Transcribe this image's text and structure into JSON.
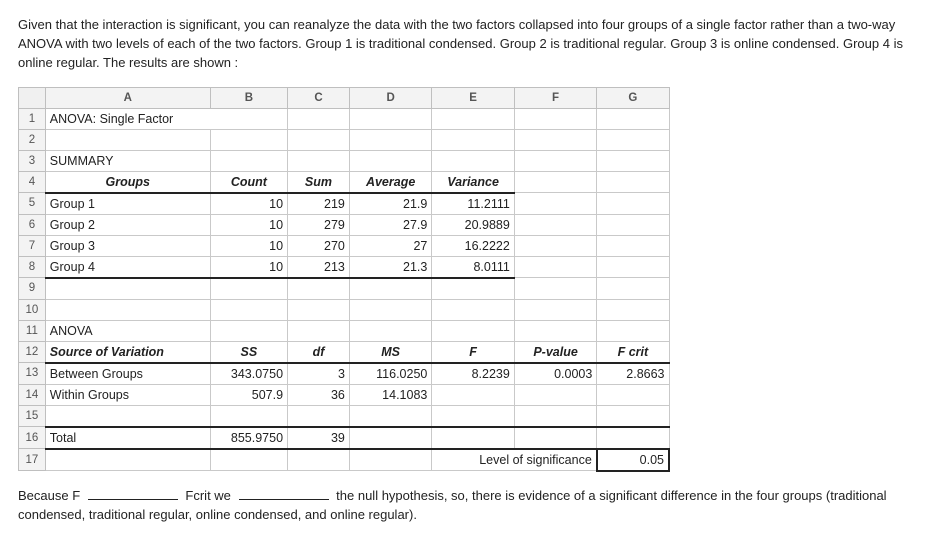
{
  "intro": "Given that the interaction is significant, you can reanalyze the data with the two factors collapsed into four groups of a single factor rather than a two-way ANOVA with two levels of each of the two factors.  Group 1 is traditional condensed. Group 2 is traditional regular. Group 3 is online condensed. Group 4 is online regular. The results are shown :",
  "cols": {
    "A": "A",
    "B": "B",
    "C": "C",
    "D": "D",
    "E": "E",
    "F": "F",
    "G": "G"
  },
  "rows": {
    "r1A": "ANOVA: Single Factor",
    "r3A": "SUMMARY",
    "r4": {
      "A": "Groups",
      "B": "Count",
      "C": "Sum",
      "D": "Average",
      "E": "Variance"
    },
    "r5": {
      "A": "Group 1",
      "B": "10",
      "C": "219",
      "D": "21.9",
      "E": "11.2111"
    },
    "r6": {
      "A": "Group 2",
      "B": "10",
      "C": "279",
      "D": "27.9",
      "E": "20.9889"
    },
    "r7": {
      "A": "Group 3",
      "B": "10",
      "C": "270",
      "D": "27",
      "E": "16.2222"
    },
    "r8": {
      "A": "Group 4",
      "B": "10",
      "C": "213",
      "D": "21.3",
      "E": "8.0111"
    },
    "r11A": "ANOVA",
    "r12": {
      "A": "Source of Variation",
      "B": "SS",
      "C": "df",
      "D": "MS",
      "E": "F",
      "F": "P-value",
      "G": "F crit"
    },
    "r13": {
      "A": "Between Groups",
      "B": "343.0750",
      "C": "3",
      "D": "116.0250",
      "E": "8.2239",
      "F": "0.0003",
      "G": "2.8663"
    },
    "r14": {
      "A": "Within Groups",
      "B": "507.9",
      "C": "36",
      "D": "14.1083"
    },
    "r16": {
      "A": "Total",
      "B": "855.9750",
      "C": "39"
    },
    "r17": {
      "label": "Level of significance",
      "val": "0.05"
    }
  },
  "question": {
    "p1a": "Because F",
    "p1b": "Fcrit  we",
    "p1c": "the null hypothesis, so, there is evidence of a significant difference in the four groups (traditional condensed, traditional regular, online condensed, and online regular)."
  },
  "chart_data": {
    "type": "table",
    "title": "ANOVA: Single Factor",
    "summary": {
      "columns": [
        "Groups",
        "Count",
        "Sum",
        "Average",
        "Variance"
      ],
      "rows": [
        {
          "Groups": "Group 1",
          "Count": 10,
          "Sum": 219,
          "Average": 21.9,
          "Variance": 11.2111
        },
        {
          "Groups": "Group 2",
          "Count": 10,
          "Sum": 279,
          "Average": 27.9,
          "Variance": 20.9889
        },
        {
          "Groups": "Group 3",
          "Count": 10,
          "Sum": 270,
          "Average": 27,
          "Variance": 16.2222
        },
        {
          "Groups": "Group 4",
          "Count": 10,
          "Sum": 213,
          "Average": 21.3,
          "Variance": 8.0111
        }
      ]
    },
    "anova": {
      "columns": [
        "Source of Variation",
        "SS",
        "df",
        "MS",
        "F",
        "P-value",
        "F crit"
      ],
      "rows": [
        {
          "Source of Variation": "Between Groups",
          "SS": 343.075,
          "df": 3,
          "MS": 116.025,
          "F": 8.2239,
          "P-value": 0.0003,
          "F crit": 2.8663
        },
        {
          "Source of Variation": "Within Groups",
          "SS": 507.9,
          "df": 36,
          "MS": 14.1083
        },
        {
          "Source of Variation": "Total",
          "SS": 855.975,
          "df": 39
        }
      ],
      "level_of_significance": 0.05
    }
  }
}
